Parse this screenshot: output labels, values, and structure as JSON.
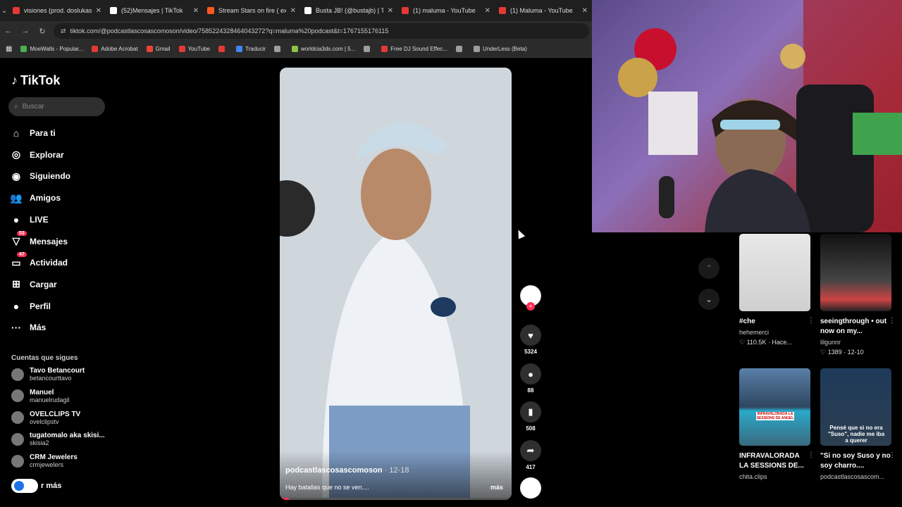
{
  "tabs": [
    {
      "label": "visiones (prod. doslukas)",
      "color": "#e53935"
    },
    {
      "label": "(52)Mensajes | TikTok",
      "color": "#ffffff"
    },
    {
      "label": "Stream Stars on fire ( exte",
      "color": "#ff5722"
    },
    {
      "label": "Busta JB! (@bustajb) | Tik",
      "color": "#ffffff"
    },
    {
      "label": "(1) maluma - YouTube",
      "color": "#e53935"
    },
    {
      "label": "(1) Maluma - YouTube",
      "color": "#e53935"
    }
  ],
  "address": {
    "url": "tiktok.com/@podcastlascosascomoson/video/7585224328464043272?q=maluma%20podcast&t=1767155176115"
  },
  "bookmarks": [
    {
      "label": "MoeWalls - Popular...",
      "color": "#4caf50"
    },
    {
      "label": "Adobe Acrobat",
      "color": "#e53935"
    },
    {
      "label": "Gmail",
      "color": "#ea4335"
    },
    {
      "label": "YouTube",
      "color": "#e53935"
    },
    {
      "label": "",
      "color": "#e53935"
    },
    {
      "label": "Traducir",
      "color": "#4285f4"
    },
    {
      "label": "",
      "color": "#9e9e9e"
    },
    {
      "label": "worldcia3ds.com | 5...",
      "color": "#8bc34a"
    },
    {
      "label": "",
      "color": "#9e9e9e"
    },
    {
      "label": "Free DJ Sound Effec...",
      "color": "#e53935"
    },
    {
      "label": "",
      "color": "#9e9e9e"
    },
    {
      "label": "UnderLess (Beta)",
      "color": "#9e9e9e"
    }
  ],
  "sidebar": {
    "logo": "TikTok",
    "search_placeholder": "Buscar",
    "nav": [
      {
        "label": "Para ti",
        "icon": "⌂"
      },
      {
        "label": "Explorar",
        "icon": "◎"
      },
      {
        "label": "Siguiendo",
        "icon": "◉"
      },
      {
        "label": "Amigos",
        "icon": "👥"
      },
      {
        "label": "LIVE",
        "icon": "●"
      },
      {
        "label": "Mensajes",
        "icon": "▽",
        "badge": "53"
      },
      {
        "label": "Actividad",
        "icon": "▭",
        "badge": "47"
      },
      {
        "label": "Cargar",
        "icon": "⊞"
      },
      {
        "label": "Perfil",
        "icon": "●"
      },
      {
        "label": "Más",
        "icon": "···"
      }
    ],
    "following_title": "Cuentas que sigues",
    "following": [
      {
        "name": "Tavo Betancourt",
        "handle": "betancourttavo"
      },
      {
        "name": "Manuel",
        "handle": "manuelrudagil"
      },
      {
        "name": "OVELCLIPS TV",
        "handle": "ovelclipstv"
      },
      {
        "name": "tugatomalo aka skisi...",
        "handle": "skisia2"
      },
      {
        "name": "CRM Jewelers",
        "handle": "crmjewelers"
      }
    ],
    "see_more": "r más"
  },
  "video": {
    "author": "podcastlascosascomoson",
    "date": "· 12-18",
    "caption": "Hay batallas que no se ven....",
    "more": "más"
  },
  "actions": {
    "likes": "5324",
    "comments": "88",
    "saves": "508",
    "shares": "417"
  },
  "grid": [
    {
      "title": "#che",
      "author": "hehemerci",
      "meta": "♡ 110.5K · Hace...",
      "bg": "linear-gradient(#e8e8e8,#cfcfcf)"
    },
    {
      "title": "seeingthrough • out now on my...",
      "author": "lilgunnr",
      "meta": "♡ 1389 · 12-10",
      "bg": "linear-gradient(#111,#444 60%,#c44 85%,#222)"
    },
    {
      "title": "INFRAVALORADA LA SESSIONS DE...",
      "author": "chita.clips",
      "meta": "",
      "bg": "linear-gradient(#5a7fa8,#2e4660 50%,#2aa9c9 55%,#3a6a7e)"
    },
    {
      "title": "\"Si no soy Suso y no soy charro....",
      "author": "podcastlascosascom...",
      "meta": "",
      "bg": "linear-gradient(#1e3a5a,#2c3e50)"
    }
  ],
  "grid_thumb_text": {
    "card2": "INFRAVALORADA LA SESSIONS DE ANGEL",
    "card3": "Pensé que si no era \"Suso\", nadie me iba a querer"
  }
}
